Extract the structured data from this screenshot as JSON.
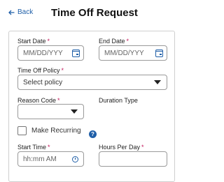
{
  "header": {
    "back_label": "Back",
    "title": "Time Off Request"
  },
  "form": {
    "start_date": {
      "label": "Start Date",
      "required": "*",
      "placeholder": "MM/DD/YYY"
    },
    "end_date": {
      "label": "End Date",
      "required": "*",
      "placeholder": "MM/DD/YYY"
    },
    "time_off_policy": {
      "label": "Time Off Policy",
      "required": "*",
      "value": "Select policy"
    },
    "reason_code": {
      "label": "Reason Code",
      "required": "*",
      "value": ""
    },
    "duration_type": {
      "label": "Duration Type"
    },
    "make_recurring": {
      "label": "Make Recurring",
      "checked": false,
      "help_icon": "question-circle-icon"
    },
    "start_time": {
      "label": "Start Time",
      "required": "*",
      "placeholder": "hh:mm AM"
    },
    "hours_per_day": {
      "label": "Hours Per Day",
      "required": "*",
      "value": ""
    }
  },
  "colors": {
    "accent": "#1f5fa8",
    "required": "#c2185b",
    "border": "#9a9a9a"
  },
  "icons": [
    "back-arrow-icon",
    "calendar-icon",
    "chevron-down-icon",
    "question-circle-icon",
    "clock-icon"
  ]
}
